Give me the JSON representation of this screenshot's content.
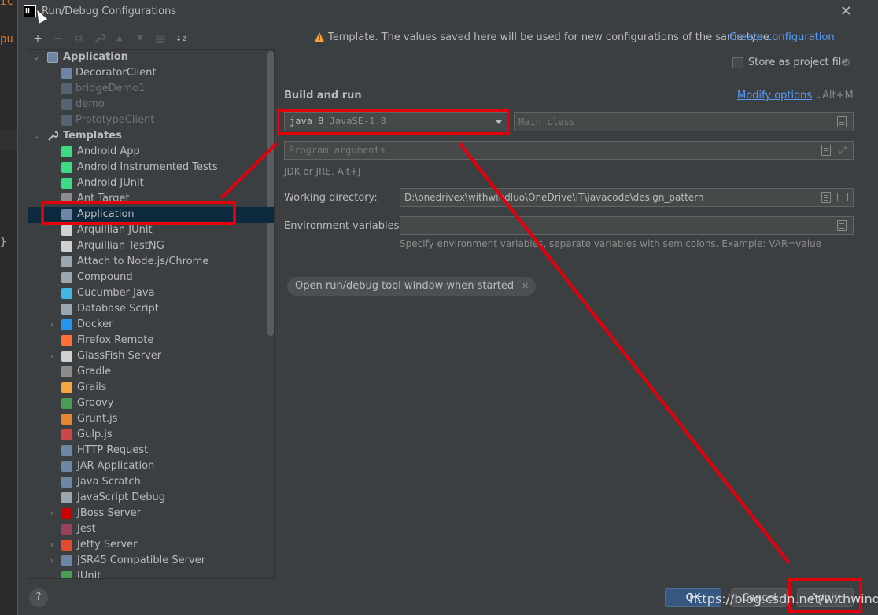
{
  "background": {
    "code_line_1": "ic",
    "code_line_2": "pu",
    "code_line_3": "}"
  },
  "title": {
    "app_icon_text": "IJ",
    "text": "Run/Debug Configurations",
    "close": "✕"
  },
  "toolbar": {
    "add": "+",
    "remove": "−",
    "copy": "⧉",
    "wrench": "🔧",
    "up": "▲",
    "down": "▼",
    "folder": "▤",
    "sort": "↓z"
  },
  "tree": {
    "application_group": "Application",
    "configs": [
      "DecoratorClient",
      "bridgeDemo1",
      "demo",
      "PrototypeClient"
    ],
    "templates_group": "Templates",
    "templates": [
      {
        "label": "Android App",
        "icon": "android-icon",
        "color": "#3ddc84",
        "arrow": ""
      },
      {
        "label": "Android Instrumented Tests",
        "icon": "android-icon",
        "color": "#3ddc84",
        "arrow": ""
      },
      {
        "label": "Android JUnit",
        "icon": "android-icon",
        "color": "#3ddc84",
        "arrow": ""
      },
      {
        "label": "Ant Target",
        "icon": "ant-icon",
        "color": "#8c8c8c",
        "arrow": ""
      },
      {
        "label": "Application",
        "icon": "application-icon",
        "color": "#6e86a5",
        "arrow": ""
      },
      {
        "label": "Arquillian JUnit",
        "icon": "arquillian-icon",
        "color": "#d0d0d0",
        "arrow": ""
      },
      {
        "label": "Arquillian TestNG",
        "icon": "arquillian-icon",
        "color": "#d0d0d0",
        "arrow": ""
      },
      {
        "label": "Attach to Node.js/Chrome",
        "icon": "nodejs-icon",
        "color": "#9aa7b0",
        "arrow": ""
      },
      {
        "label": "Compound",
        "icon": "compound-icon",
        "color": "#9aa7b0",
        "arrow": ""
      },
      {
        "label": "Cucumber Java",
        "icon": "cucumber-icon",
        "color": "#40b6e0",
        "arrow": ""
      },
      {
        "label": "Database Script",
        "icon": "database-icon",
        "color": "#9aa7b0",
        "arrow": ""
      },
      {
        "label": "Docker",
        "icon": "docker-icon",
        "color": "#2496ed",
        "arrow": "›"
      },
      {
        "label": "Firefox Remote",
        "icon": "firefox-icon",
        "color": "#ff7139",
        "arrow": ""
      },
      {
        "label": "GlassFish Server",
        "icon": "glassfish-icon",
        "color": "#d0d0d0",
        "arrow": "›"
      },
      {
        "label": "Gradle",
        "icon": "gradle-icon",
        "color": "#8c8c8c",
        "arrow": ""
      },
      {
        "label": "Grails",
        "icon": "grails-icon",
        "color": "#f4a540",
        "arrow": ""
      },
      {
        "label": "Groovy",
        "icon": "groovy-icon",
        "color": "#499c54",
        "arrow": ""
      },
      {
        "label": "Grunt.js",
        "icon": "grunt-icon",
        "color": "#e48632",
        "arrow": ""
      },
      {
        "label": "Gulp.js",
        "icon": "gulp-icon",
        "color": "#cf4647",
        "arrow": ""
      },
      {
        "label": "HTTP Request",
        "icon": "http-icon",
        "color": "#6e86a5",
        "arrow": ""
      },
      {
        "label": "JAR Application",
        "icon": "jar-icon",
        "color": "#6e86a5",
        "arrow": ""
      },
      {
        "label": "Java Scratch",
        "icon": "java-scratch-icon",
        "color": "#6e86a5",
        "arrow": ""
      },
      {
        "label": "JavaScript Debug",
        "icon": "js-debug-icon",
        "color": "#9aa7b0",
        "arrow": ""
      },
      {
        "label": "JBoss Server",
        "icon": "jboss-icon",
        "color": "#cc0000",
        "arrow": "›"
      },
      {
        "label": "Jest",
        "icon": "jest-icon",
        "color": "#99425b",
        "arrow": ""
      },
      {
        "label": "Jetty Server",
        "icon": "jetty-icon",
        "color": "#e34a2f",
        "arrow": "›"
      },
      {
        "label": "JSR45 Compatible Server",
        "icon": "jsr45-icon",
        "color": "#6e86a5",
        "arrow": "›"
      },
      {
        "label": "JUnit",
        "icon": "junit-icon",
        "color": "#499c54",
        "arrow": ""
      }
    ]
  },
  "header": {
    "template_note": "Template. The values saved here will be used for new configurations of the same type",
    "create_link": "Create configuration",
    "store_label": "Store as project file"
  },
  "build": {
    "section_title": "Build and run",
    "modify_options": "Modify options",
    "modify_shortcut": "Alt+M",
    "jdk_main": "java 8",
    "jdk_sub": "JavaSE-1.8",
    "main_class_placeholder": "Main class",
    "program_args_placeholder": "Program arguments",
    "jdk_hint": "JDK or JRE. Alt+J",
    "working_dir_label": "Working directory:",
    "working_dir_value": "D:\\onedrivex\\withwindluo\\OneDrive\\IT\\javacode\\design_pattern",
    "env_label": "Environment variables:",
    "env_hint": "Specify environment variables, separate variables with semicolons. Example: VAR=value",
    "chip_label": "Open run/debug tool window when started"
  },
  "footer": {
    "help": "?",
    "ok": "OK",
    "cancel": "Cancel",
    "apply": "Apply"
  },
  "watermark": "https://blog.csdn.net/withwindluo",
  "colors": {
    "accent_link": "#589df6",
    "annotation_red": "#e3000b",
    "selection": "#0d293e"
  }
}
